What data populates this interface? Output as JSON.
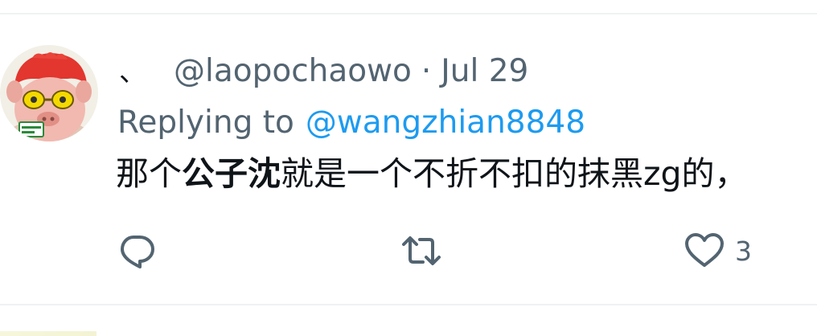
{
  "tweet": {
    "display_name": "、",
    "handle": "@laopochaowo",
    "separator": "·",
    "date": "Jul 29",
    "replying_label": "Replying to",
    "replying_to": "@wangzhian8848",
    "text_pre": "那个",
    "text_bold": "公子沈",
    "text_post": "就是一个不折不扣的抹黑zg的，"
  },
  "actions": {
    "reply_icon": "comment-icon",
    "retweet_icon": "retweet-icon",
    "like_icon": "heart-icon",
    "like_count": "3"
  },
  "colors": {
    "text_primary": "#0f1419",
    "text_secondary": "#536471",
    "link": "#1d9bf0",
    "divider": "#eff1f3"
  }
}
